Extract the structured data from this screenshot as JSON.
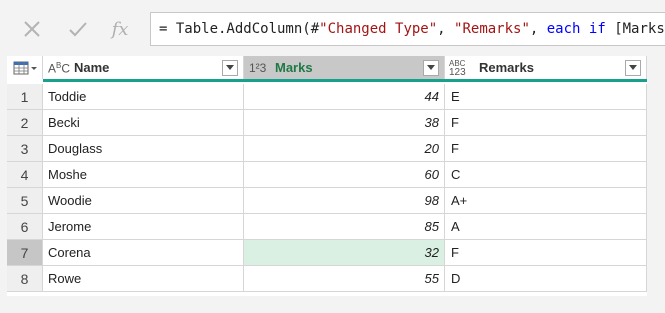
{
  "formula_bar": {
    "cancel_icon": "close-icon",
    "commit_icon": "check-icon",
    "fx_label": "fx",
    "formula": {
      "prefix": "= Table.AddColumn(#",
      "str1": "\"Changed Type\"",
      "sep1": ", ",
      "str2": "\"Remarks\"",
      "sep2": ", ",
      "kw1": "each",
      "sp1": " ",
      "kw2": "if",
      "rest": " [Marks]"
    }
  },
  "table": {
    "columns": [
      {
        "type_label_top": "A",
        "type_label_sub": "B",
        "type_label_c": "C",
        "name": "Name"
      },
      {
        "type_label": "1²3",
        "name": "Marks"
      },
      {
        "type_label_top": "ABC",
        "type_label_bottom": "123",
        "name": "Remarks"
      }
    ],
    "rows": [
      {
        "idx": "1",
        "name": "Toddie",
        "marks": "44",
        "remarks": "E"
      },
      {
        "idx": "2",
        "name": "Becki",
        "marks": "38",
        "remarks": "F"
      },
      {
        "idx": "3",
        "name": "Douglass",
        "marks": "20",
        "remarks": "F"
      },
      {
        "idx": "4",
        "name": "Moshe",
        "marks": "60",
        "remarks": "C"
      },
      {
        "idx": "5",
        "name": "Woodie",
        "marks": "98",
        "remarks": "A+"
      },
      {
        "idx": "6",
        "name": "Jerome",
        "marks": "85",
        "remarks": "A"
      },
      {
        "idx": "7",
        "name": "Corena",
        "marks": "32",
        "remarks": "F"
      },
      {
        "idx": "8",
        "name": "Rowe",
        "marks": "55",
        "remarks": "D"
      }
    ],
    "selected_row": "7",
    "selected_column": "Marks"
  },
  "colors": {
    "accent_teal": "#19a08c",
    "selected_column_header": "#c8c8c8",
    "selected_cell": "#d9f0e2",
    "column_name_selected": "#1e7a45"
  }
}
